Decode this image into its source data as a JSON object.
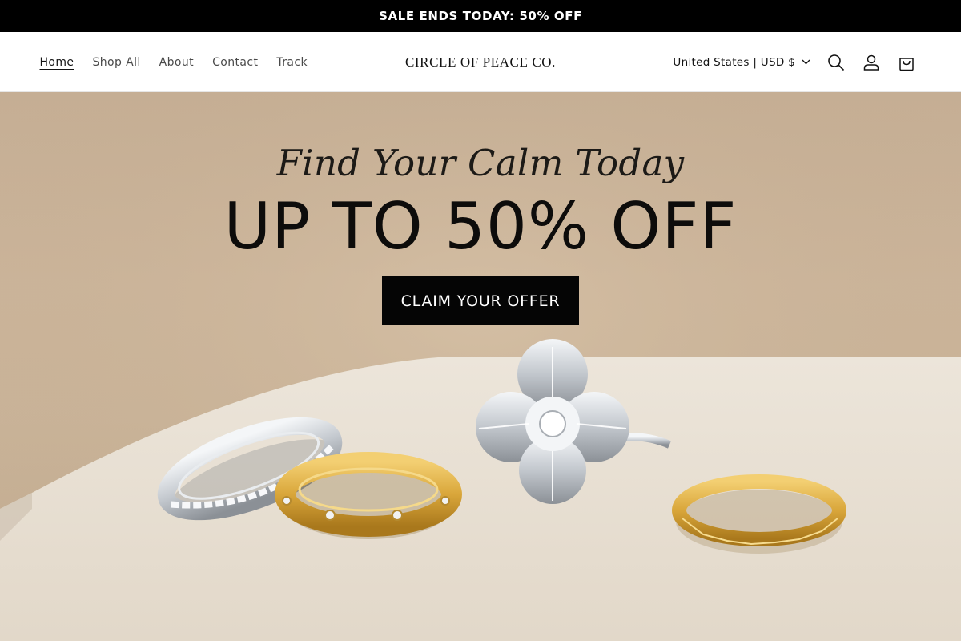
{
  "announcement": {
    "text": "SALE ENDS TODAY: 50% OFF"
  },
  "header": {
    "nav": [
      {
        "label": "Home",
        "active": true
      },
      {
        "label": "Shop All"
      },
      {
        "label": "About"
      },
      {
        "label": "Contact"
      },
      {
        "label": "Track"
      }
    ],
    "logo": "CIRCLE OF PEACE CO.",
    "locale": "United States | USD $",
    "icons": [
      "chevron-down-icon",
      "search-icon",
      "account-icon",
      "cart-icon"
    ]
  },
  "hero": {
    "tagline": "Find Your Calm Today",
    "headline": "UP TO 50% OFF",
    "cta": "CLAIM YOUR OFFER",
    "products": [
      "silver-spinner-ring",
      "gold-stone-spinner-ring",
      "silver-clover-cocktail-ring",
      "gold-faceted-band"
    ]
  },
  "colors": {
    "announcement_bg": "#000000",
    "cta_bg": "#050505",
    "hero_backdrop": "#c9b398",
    "pedestal": "#e6ddd0",
    "gold": "#d9a63a",
    "silver": "#cfd3d8"
  }
}
